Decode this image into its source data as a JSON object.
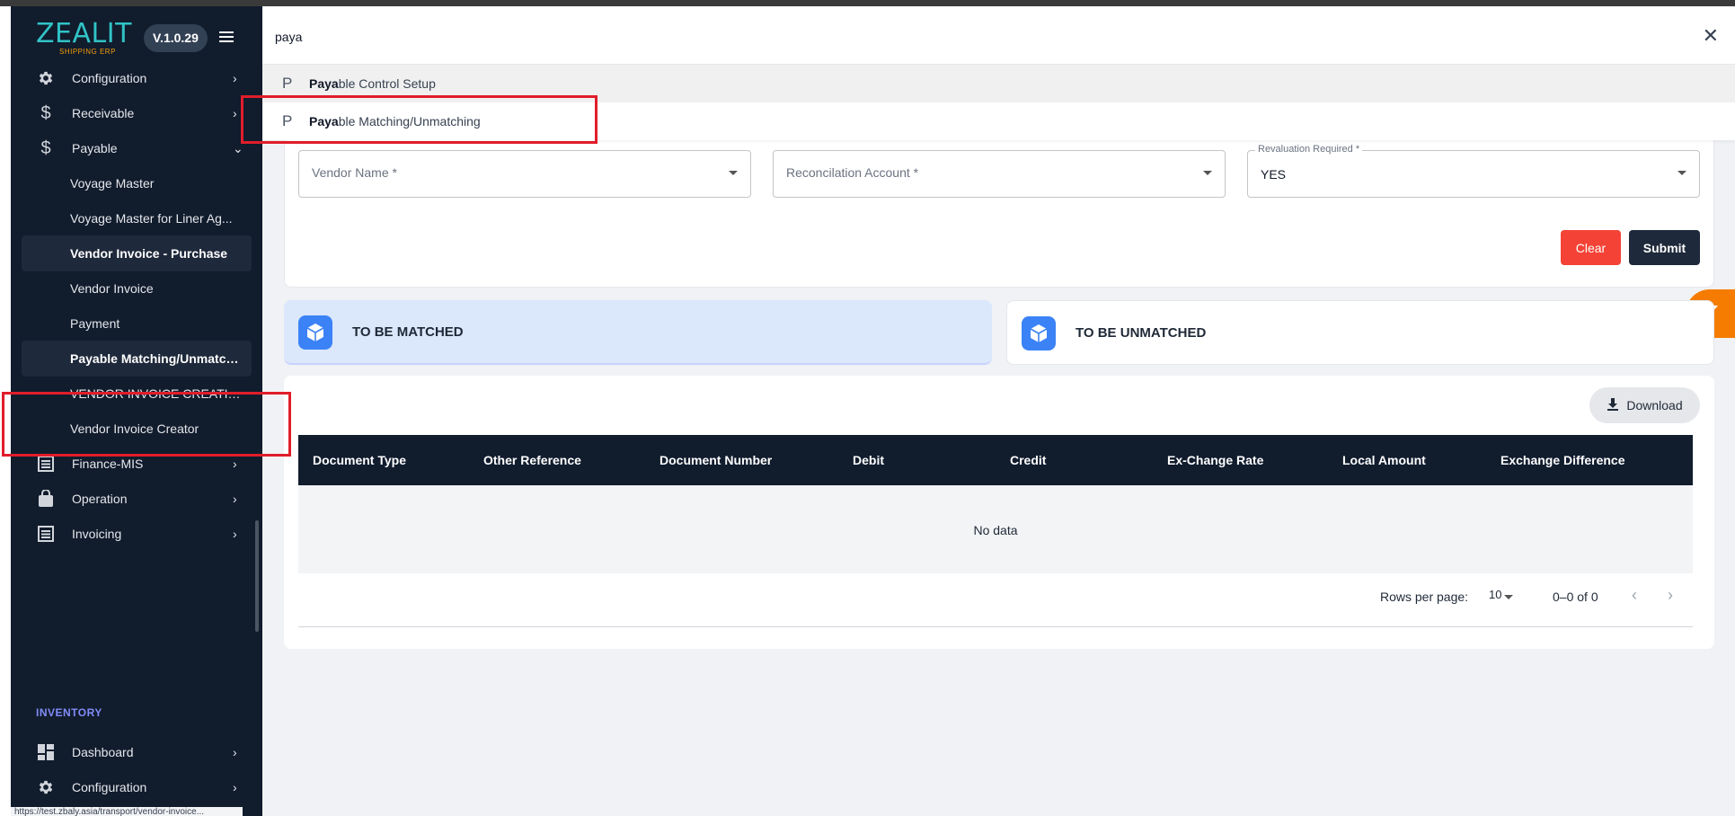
{
  "app": {
    "logo": "ZEALIT",
    "logo_sub": "SHIPPING ERP",
    "version": "V.1.0.29"
  },
  "sidebar": {
    "items": [
      {
        "label": "Configuration",
        "icon": "gear-icon"
      },
      {
        "label": "Receivable",
        "icon": "dollar-icon"
      },
      {
        "label": "Payable",
        "icon": "dollar-icon"
      }
    ],
    "payable_sub": [
      {
        "label": "Voyage Master"
      },
      {
        "label": "Voyage Master for Liner Ag..."
      },
      {
        "label": "Vendor Invoice - Purchase"
      },
      {
        "label": "Vendor Invoice"
      },
      {
        "label": "Payment"
      },
      {
        "label": "Payable Matching/Unmatch..."
      },
      {
        "label": "VENDOR INVOICE CREATION"
      },
      {
        "label": "Vendor Invoice Creator"
      }
    ],
    "more_items": [
      {
        "label": "Finance-MIS",
        "icon": "list-icon"
      },
      {
        "label": "Operation",
        "icon": "bag-icon"
      },
      {
        "label": "Invoicing",
        "icon": "list-icon"
      }
    ],
    "section_inventory": "INVENTORY",
    "inventory_items": [
      {
        "label": "Dashboard",
        "icon": "dashboard-icon"
      },
      {
        "label": "Configuration",
        "icon": "gear-icon"
      }
    ],
    "status_url": "https://test.zbaly.asia/transport/vendor-invoice..."
  },
  "search": {
    "query": "paya",
    "results": [
      {
        "letter": "P",
        "match": "Paya",
        "rest": "ble Control Setup"
      },
      {
        "letter": "P",
        "match": "Paya",
        "rest": "ble Matching/Unmatching"
      }
    ]
  },
  "form": {
    "vendor_placeholder": "Vendor Name *",
    "recon_placeholder": "Reconcilation Account *",
    "revaluation_label": "Revaluation Required *",
    "revaluation_value": "YES",
    "clear_label": "Clear",
    "submit_label": "Submit"
  },
  "tabs": [
    {
      "label": "TO BE MATCHED",
      "active": true
    },
    {
      "label": "TO BE UNMATCHED",
      "active": false
    }
  ],
  "table": {
    "download_label": "Download",
    "columns": [
      "Document Type",
      "Other Reference",
      "Document Number",
      "Debit",
      "Credit",
      "Ex-Change Rate",
      "Local Amount",
      "Exchange Difference"
    ],
    "empty_text": "No data",
    "rows_per_page_label": "Rows per page:",
    "rows_per_page_value": "10",
    "range_text": "0–0 of 0"
  },
  "colors": {
    "sidebar_bg": "#111c2d",
    "accent_blue": "#3b82f6",
    "clear_red": "#f44336",
    "fab_orange": "#f57c00",
    "highlight_box": "#e11d2a"
  }
}
